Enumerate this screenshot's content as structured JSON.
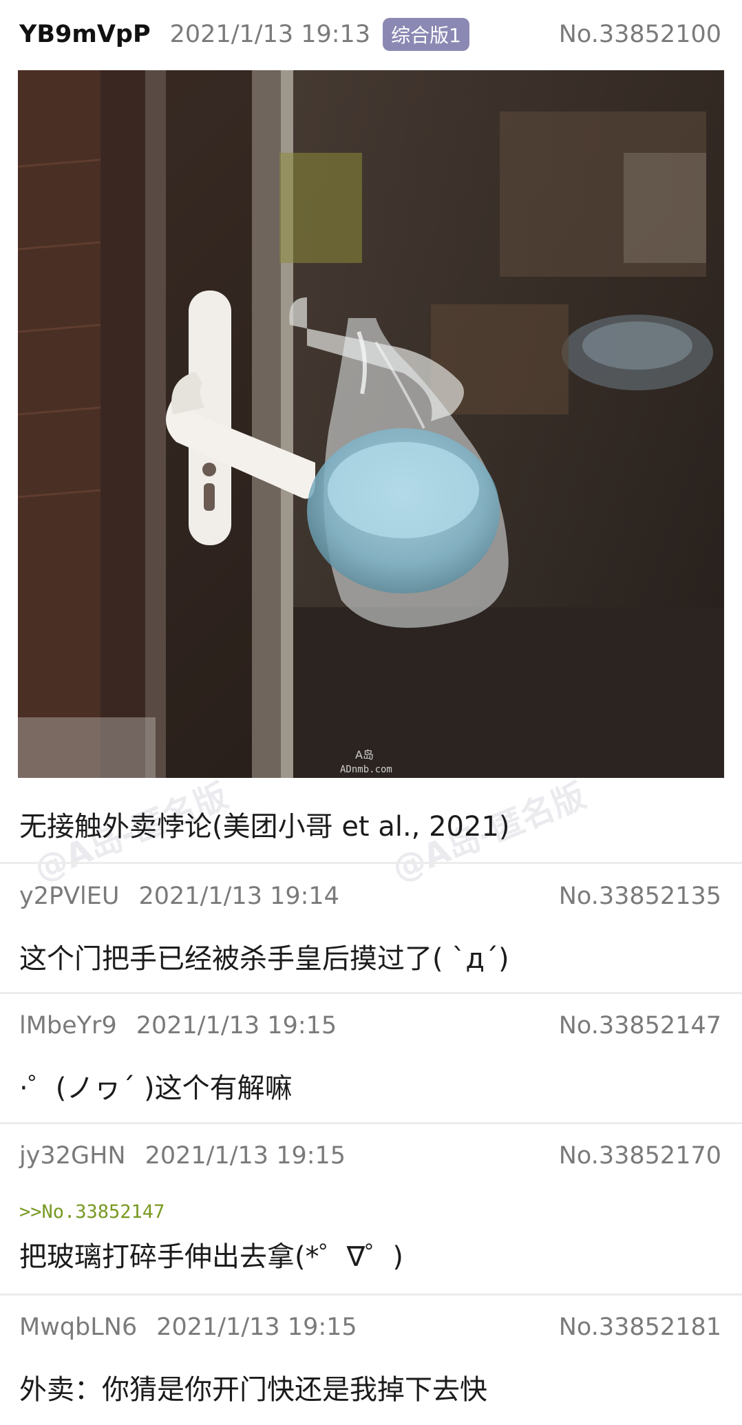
{
  "thread": {
    "op": {
      "user_id": "YB9mVpP",
      "time": "2021/1/13 19:13",
      "board_badge": "综合版1",
      "post_no": "No.33852100",
      "image_watermark_line1": "A岛",
      "image_watermark_line2": "ADnmb.com",
      "content": "无接触外卖悖论(美团小哥 et al., 2021)"
    },
    "replies": [
      {
        "user_id": "y2PVlEU",
        "time": "2021/1/13 19:14",
        "post_no": "No.33852135",
        "quote": "",
        "content": "这个门把手已经被杀手皇后摸过了( `д´)"
      },
      {
        "user_id": "lMbeYr9",
        "time": "2021/1/13 19:15",
        "post_no": "No.33852147",
        "quote": "",
        "content": "·゜(ノヮ´ )这个有解嘛"
      },
      {
        "user_id": "jy32GHN",
        "time": "2021/1/13 19:15",
        "post_no": "No.33852170",
        "quote": ">>No.33852147",
        "content": "把玻璃打碎手伸出去拿(*゜∇゜)"
      },
      {
        "user_id": "MwqbLN6",
        "time": "2021/1/13 19:15",
        "post_no": "No.33852181",
        "quote": "",
        "content": "外卖：你猜是你开门快还是我掉下去快"
      }
    ]
  },
  "watermark_text": "@A岛-匿名版"
}
